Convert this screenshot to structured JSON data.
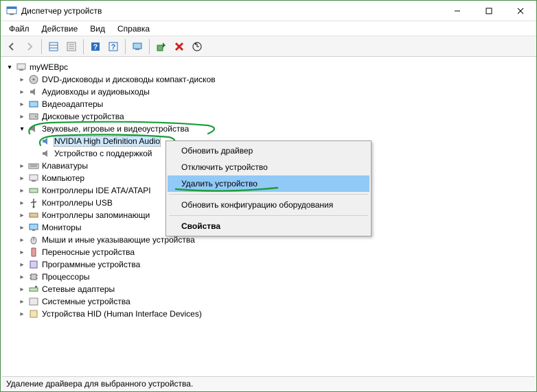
{
  "window": {
    "title": "Диспетчер устройств"
  },
  "menu": {
    "file": "Файл",
    "action": "Действие",
    "view": "Вид",
    "help": "Справка"
  },
  "tree": {
    "root": "myWEBpc",
    "nodes": {
      "dvd": "DVD-дисководы и дисководы компакт-дисков",
      "audio_io": "Аудиовходы и аудиовыходы",
      "video_adapters": "Видеоадаптеры",
      "disk_devices": "Дисковые устройства",
      "sound_game_video": "Звуковые, игровые и видеоустройства",
      "nvidia_hda": "NVIDIA High Definition Audio",
      "device_with_support": "Устройство с поддержкой",
      "keyboards": "Клавиатуры",
      "computer": "Компьютер",
      "ide_ata": "Контроллеры IDE ATA/ATAPI",
      "usb_controllers": "Контроллеры USB",
      "storage_controllers": "Контроллеры запоминающи",
      "monitors": "Мониторы",
      "mice": "Мыши и иные указывающие устройства",
      "portable": "Переносные устройства",
      "software_devices": "Программные устройства",
      "processors": "Процессоры",
      "network_adapters": "Сетевые адаптеры",
      "system_devices": "Системные устройства",
      "hid": "Устройства HID (Human Interface Devices)"
    }
  },
  "context_menu": {
    "update_driver": "Обновить драйвер",
    "disable_device": "Отключить устройство",
    "uninstall_device": "Удалить устройство",
    "scan_hardware": "Обновить конфигурацию оборудования",
    "properties": "Свойства"
  },
  "statusbar": {
    "text": "Удаление драйвера для выбранного устройства."
  },
  "colors": {
    "annotation": "#1a9e3a",
    "selection": "#cce8ff",
    "ctx_highlight": "#91c9f7"
  }
}
